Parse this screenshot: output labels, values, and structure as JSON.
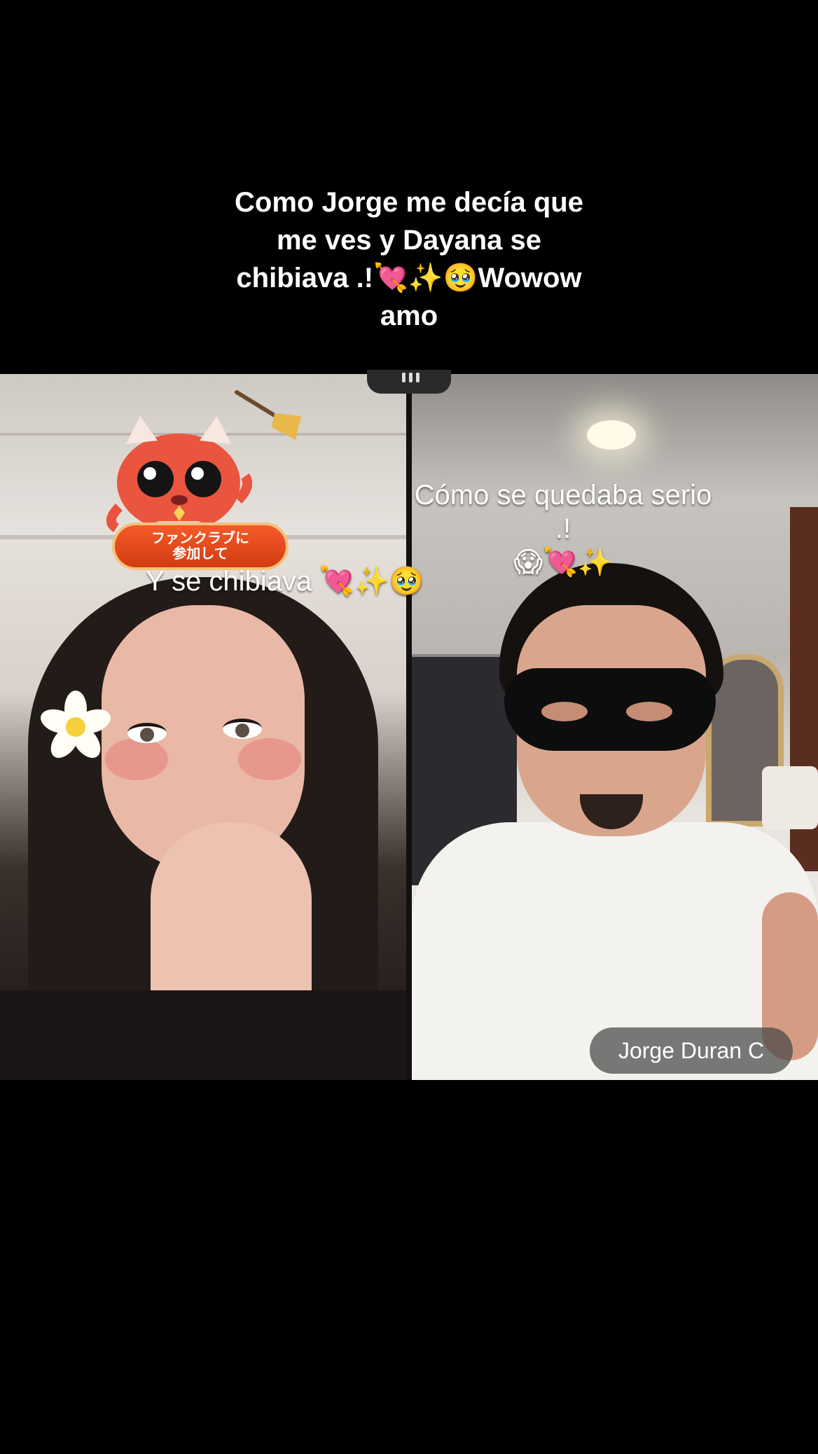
{
  "caption": {
    "line1": "Como Jorge me decía que",
    "line2": "me ves y Dayana se",
    "line3": "chibiava .!💘✨🥹Wowow",
    "line4": "amo"
  },
  "left_panel": {
    "badge_line1": "ファンクラブに",
    "badge_line2": "参加して",
    "overlay_text": "Y se chibiava 💘✨🥹"
  },
  "right_panel": {
    "overlay_text_line1": "Cómo se quedaba serio .!",
    "overlay_text_line2": "😱💘✨",
    "name_tag": "Jorge Duran C"
  },
  "colors": {
    "background": "#000000",
    "badge": "#e4461a",
    "badge_border": "#f6c27a",
    "name_tag_bg": "#464646"
  }
}
